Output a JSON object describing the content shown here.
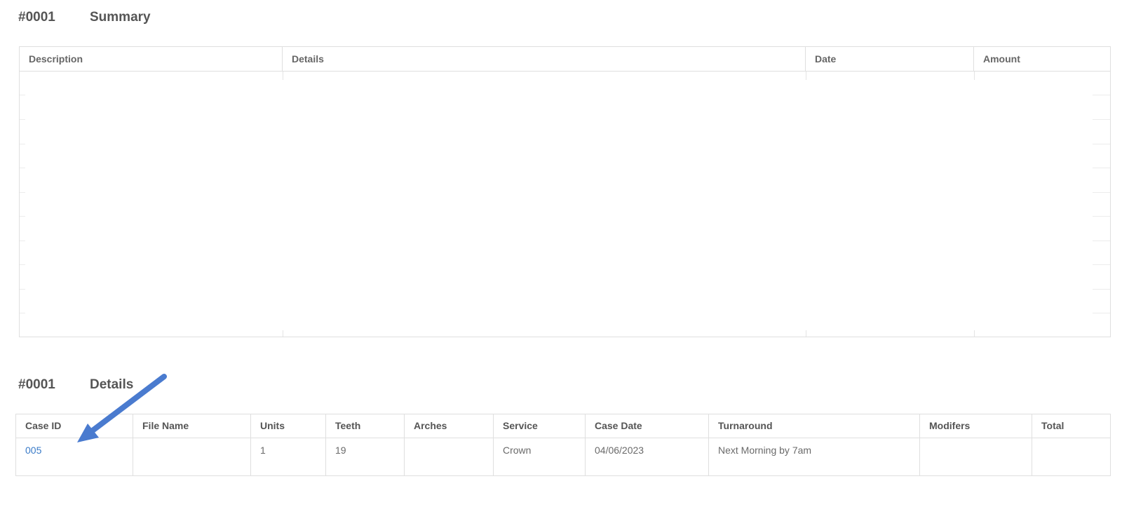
{
  "summary": {
    "invoice_number": "#0001",
    "title": "Summary",
    "columns": [
      "Description",
      "Details",
      "Date",
      "Amount"
    ]
  },
  "details": {
    "invoice_number": "#0001",
    "title": "Details",
    "columns": [
      "Case ID",
      "File Name",
      "Units",
      "Teeth",
      "Arches",
      "Service",
      "Case Date",
      "Turnaround",
      "Modifers",
      "Total"
    ],
    "rows": [
      {
        "case_id": "005",
        "file_name": "",
        "units": "1",
        "teeth": "19",
        "arches": "",
        "service": "Crown",
        "case_date": "04/06/2023",
        "turnaround": "Next Morning by 7am",
        "modifiers": "",
        "total": ""
      }
    ]
  },
  "colors": {
    "link": "#3a7bc8",
    "arrow": "#4a7bcf",
    "border": "#dfdfdf"
  },
  "annotation": {
    "icon": "arrow-annotation-icon"
  }
}
